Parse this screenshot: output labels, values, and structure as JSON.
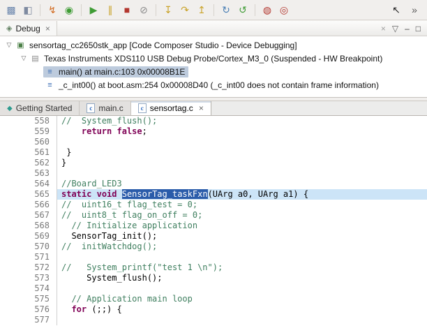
{
  "colors": {
    "selection_bg": "#2a5caa",
    "current_line_bg": "#cce4f7",
    "comment": "#3f7f5f",
    "keyword": "#7f0055",
    "tree_selection_bg": "#bdcbdd"
  },
  "glyphs": {
    "close": "×",
    "expander": "▽"
  },
  "toolbar": {
    "left": [
      {
        "name": "new-wizard-button",
        "glyph": "▩",
        "color": "#6b86ad"
      },
      {
        "name": "save-button",
        "glyph": "◧",
        "color": "#7e8aa0"
      },
      {
        "separator": true
      },
      {
        "name": "flash-button",
        "glyph": "↯",
        "color": "#d2691e"
      },
      {
        "name": "debug-button",
        "glyph": "◉",
        "color": "#3f9c35"
      },
      {
        "separator": true
      },
      {
        "name": "resume-button",
        "glyph": "▶",
        "color": "#3f9c35"
      },
      {
        "name": "suspend-button",
        "glyph": "∥",
        "color": "#c9a227"
      },
      {
        "name": "terminate-button",
        "glyph": "■",
        "color": "#b3372f"
      },
      {
        "name": "disconnect-button",
        "glyph": "⊘",
        "color": "#8a8a8a"
      },
      {
        "separator": true
      },
      {
        "name": "step-into-button",
        "glyph": "↧",
        "color": "#c9a227"
      },
      {
        "name": "step-over-button",
        "glyph": "↷",
        "color": "#c9a227"
      },
      {
        "name": "step-return-button",
        "glyph": "↥",
        "color": "#c9a227"
      },
      {
        "separator": true
      },
      {
        "name": "reset-button",
        "glyph": "↻",
        "color": "#4a7fb5"
      },
      {
        "name": "restart-button",
        "glyph": "↺",
        "color": "#3f9c35"
      },
      {
        "separator": true
      },
      {
        "name": "profile-button",
        "glyph": "◍",
        "color": "#b3372f"
      },
      {
        "name": "trace-button",
        "glyph": "◎",
        "color": "#b3372f"
      }
    ],
    "right": [
      {
        "name": "pointer-mode-button",
        "glyph": "↖",
        "color": "#222222"
      },
      {
        "name": "toolbar-overflow-button",
        "glyph": "»",
        "color": "#555555"
      }
    ]
  },
  "debug_panel": {
    "tab_icon_glyph": "◈",
    "tab_label": "Debug",
    "toolbar": [
      {
        "name": "remove-all-terminated-button",
        "glyph": "×",
        "color": "#a0a0a0"
      },
      {
        "name": "view-menu-button",
        "glyph": "▽",
        "color": "#606060"
      },
      {
        "name": "minimize-view-button",
        "glyph": "–",
        "color": "#404040"
      },
      {
        "name": "maximize-view-button",
        "glyph": "□",
        "color": "#404040"
      }
    ],
    "tree": [
      {
        "level": 0,
        "expander": true,
        "icon": "debug-session-icon",
        "icon_glyph": "▣",
        "icon_color": "#4a7f46",
        "text": "sensortag_cc2650stk_app [Code Composer Studio - Device Debugging]",
        "selected": false
      },
      {
        "level": 1,
        "expander": true,
        "icon": "debug-probe-icon",
        "icon_glyph": "▤",
        "icon_color": "#8a8a8a",
        "text": "Texas Instruments XDS110 USB Debug Probe/Cortex_M3_0 (Suspended - HW Breakpoint)",
        "selected": false
      },
      {
        "level": 2,
        "expander": false,
        "icon": "stack-frame-icon",
        "icon_glyph": "≡",
        "icon_color": "#3b6eb5",
        "text": "main() at main.c:103 0x00008B1E",
        "selected": true
      },
      {
        "level": 2,
        "expander": false,
        "icon": "stack-frame-icon",
        "icon_glyph": "≡",
        "icon_color": "#3b6eb5",
        "text": "_c_int00() at boot.asm:254 0x00008D40 (_c_int00 does not contain frame information)",
        "selected": false
      }
    ]
  },
  "editor": {
    "tabs": [
      {
        "id": "getting-started",
        "label": "Getting Started",
        "icon_name": "getting-started-icon",
        "icon_class": "tab-icon-gs",
        "icon_glyph": "◆",
        "active": false,
        "closable": false
      },
      {
        "id": "main-c",
        "label": "main.c",
        "icon_name": "c-file-icon",
        "icon_class": "tab-icon-cfile",
        "icon_glyph": "c",
        "active": false,
        "closable": false
      },
      {
        "id": "sensortag-c",
        "label": "sensortag.c",
        "icon_name": "c-file-icon",
        "icon_class": "tab-icon-cfile",
        "icon_glyph": "c",
        "active": true,
        "closable": true
      }
    ],
    "code": {
      "lines": [
        {
          "num": 558,
          "tokens": [
            {
              "c": "comment",
              "t": "//  System_flush();"
            }
          ]
        },
        {
          "num": 559,
          "tokens": [
            {
              "c": "plain",
              "t": "    "
            },
            {
              "c": "kw",
              "t": "return"
            },
            {
              "c": "plain",
              "t": " "
            },
            {
              "c": "kw",
              "t": "false"
            },
            {
              "c": "plain",
              "t": ";"
            }
          ]
        },
        {
          "num": 560,
          "tokens": []
        },
        {
          "num": 561,
          "tokens": [
            {
              "c": "plain",
              "t": " }"
            }
          ]
        },
        {
          "num": 562,
          "tokens": [
            {
              "c": "plain",
              "t": "}"
            }
          ]
        },
        {
          "num": 563,
          "tokens": []
        },
        {
          "num": 564,
          "tokens": [
            {
              "c": "comment",
              "t": "//Board_LED3"
            }
          ]
        },
        {
          "num": 565,
          "current": true,
          "tokens": [
            {
              "c": "kw",
              "t": "static"
            },
            {
              "c": "plain",
              "t": " "
            },
            {
              "c": "kw",
              "t": "void"
            },
            {
              "c": "plain",
              "t": " "
            },
            {
              "c": "sel",
              "t": "SensorTag_taskFxn"
            },
            {
              "c": "plain",
              "t": "(UArg a0, UArg a1) {"
            }
          ]
        },
        {
          "num": 566,
          "tokens": [
            {
              "c": "comment",
              "t": "//  uint16_t flag_test = 0;"
            }
          ]
        },
        {
          "num": 567,
          "tokens": [
            {
              "c": "comment",
              "t": "//  uint8_t flag_on_off = 0;"
            }
          ]
        },
        {
          "num": 568,
          "tokens": [
            {
              "c": "comment",
              "t": "  // Initialize application"
            }
          ]
        },
        {
          "num": 569,
          "tokens": [
            {
              "c": "plain",
              "t": "  SensorTag_init();"
            }
          ]
        },
        {
          "num": 570,
          "tokens": [
            {
              "c": "comment",
              "t": "//  initWatchdog();"
            }
          ]
        },
        {
          "num": 571,
          "tokens": []
        },
        {
          "num": 572,
          "tokens": [
            {
              "c": "comment",
              "t": "//   System_printf(\"test 1 \\n\");"
            }
          ]
        },
        {
          "num": 573,
          "tokens": [
            {
              "c": "plain",
              "t": "     System_flush();"
            }
          ]
        },
        {
          "num": 574,
          "tokens": []
        },
        {
          "num": 575,
          "tokens": [
            {
              "c": "comment",
              "t": "  // Application main loop"
            }
          ]
        },
        {
          "num": 576,
          "tokens": [
            {
              "c": "plain",
              "t": "  "
            },
            {
              "c": "kw",
              "t": "for"
            },
            {
              "c": "plain",
              "t": " (;;) {"
            }
          ]
        },
        {
          "num": 577,
          "tokens": []
        }
      ]
    }
  }
}
